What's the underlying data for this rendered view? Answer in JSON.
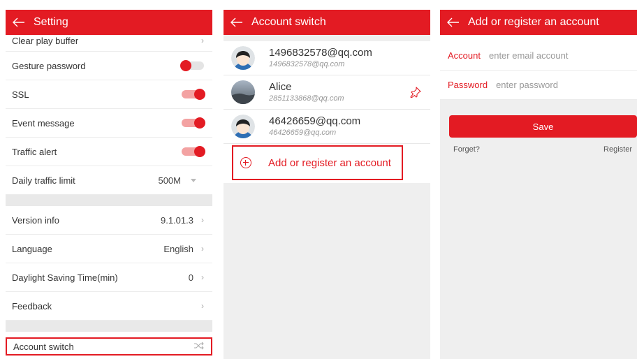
{
  "colors": {
    "accent": "#e31b23"
  },
  "settings": {
    "title": "Setting",
    "clear_play_buffer": "Clear play buffer",
    "gesture_password": "Gesture password",
    "gesture_on": false,
    "ssl": "SSL",
    "ssl_on": true,
    "event_message": "Event message",
    "event_on": true,
    "traffic_alert": "Traffic alert",
    "traffic_on": true,
    "daily_traffic_limit": "Daily traffic limit",
    "daily_traffic_value": "500M",
    "version_info": "Version info",
    "version_value": "9.1.01.3",
    "language": "Language",
    "language_value": "English",
    "daylight_saving": "Daylight Saving Time(min)",
    "daylight_value": "0",
    "feedback": "Feedback",
    "account_switch": "Account switch",
    "chevron": "›"
  },
  "account_switch": {
    "title": "Account switch",
    "accounts": [
      {
        "name": "1496832578@qq.com",
        "sub": "1496832578@qq.com",
        "avatar": "cartoon-face-avatar"
      },
      {
        "name": "Alice",
        "sub": "2851133868@qq.com",
        "avatar": "landscape-photo-avatar",
        "pinned": true
      },
      {
        "name": "46426659@qq.com",
        "sub": "46426659@qq.com",
        "avatar": "cartoon-face-avatar"
      }
    ],
    "add_label": "Add or register an account"
  },
  "register": {
    "title": "Add or register an account",
    "account_label": "Account",
    "account_placeholder": "enter email account",
    "password_label": "Password",
    "password_placeholder": "enter password",
    "save_label": "Save",
    "forget_label": "Forget?",
    "register_label": "Register"
  }
}
